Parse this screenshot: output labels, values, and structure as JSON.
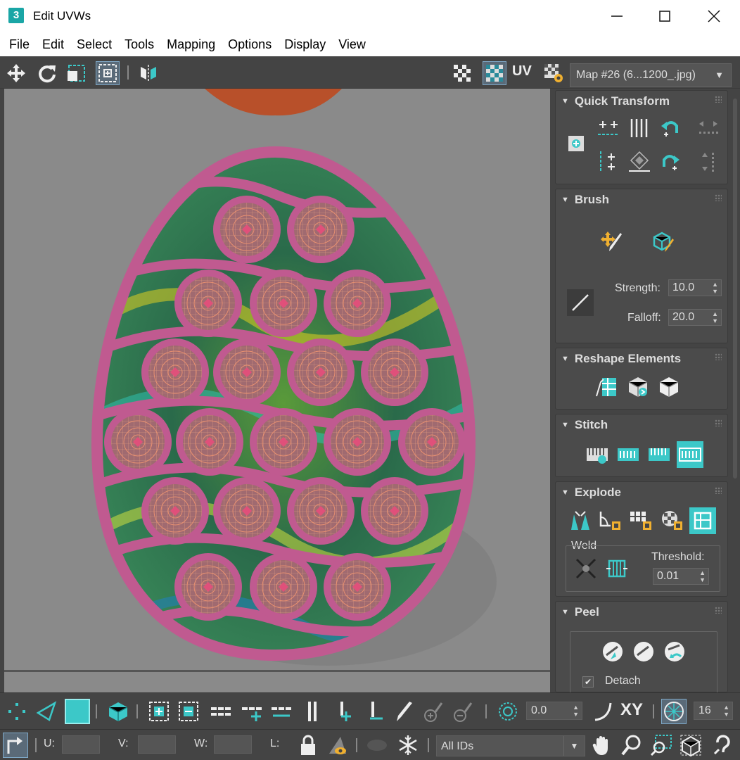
{
  "window": {
    "title": "Edit UVWs",
    "app_icon": "3"
  },
  "menu": [
    "File",
    "Edit",
    "Select",
    "Tools",
    "Mapping",
    "Options",
    "Display",
    "View"
  ],
  "toolbar": {
    "uv_label": "UV",
    "map_select": "Map #26 (6...1200_.jpg)"
  },
  "panels": {
    "quick_transform": {
      "title": "Quick Transform"
    },
    "brush": {
      "title": "Brush",
      "strength_label": "Strength:",
      "strength_value": "10.0",
      "falloff_label": "Falloff:",
      "falloff_value": "20.0"
    },
    "reshape": {
      "title": "Reshape Elements"
    },
    "stitch": {
      "title": "Stitch"
    },
    "explode": {
      "title": "Explode",
      "weld_label": "Weld",
      "threshold_label": "Threshold:",
      "threshold_value": "0.01"
    },
    "peel": {
      "title": "Peel",
      "detach_label": "Detach",
      "detach_checked": true
    }
  },
  "bottom": {
    "angle_value": "0.0",
    "xy_label": "XY",
    "grid_value": "16",
    "u_label": "U:",
    "v_label": "V:",
    "w_label": "W:",
    "l_label": "L:",
    "ids_select": "All IDs"
  },
  "colors": {
    "accent": "#3cc8c8",
    "mesh": "#b85a88",
    "highlight": "#f0b030"
  }
}
